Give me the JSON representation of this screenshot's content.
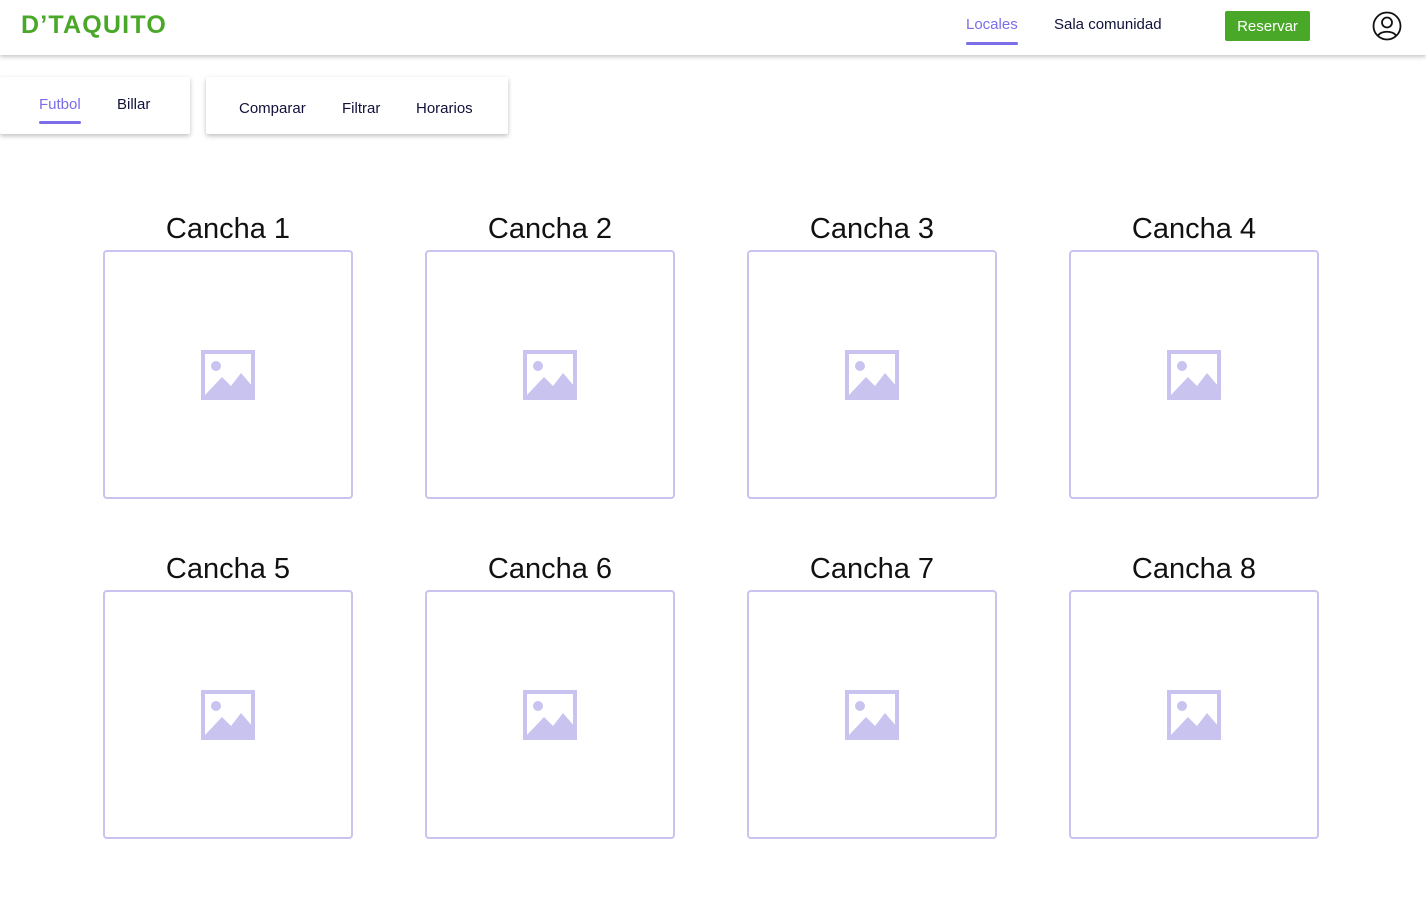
{
  "header": {
    "logo": "D’TAQUITO",
    "nav": [
      {
        "label": "Locales",
        "active": true
      },
      {
        "label": "Sala comunidad",
        "active": false
      }
    ],
    "reserve_label": "Reservar",
    "user_icon": "user-circle-icon"
  },
  "sport_tabs": [
    {
      "label": "Futbol",
      "active": true
    },
    {
      "label": "Billar",
      "active": false
    }
  ],
  "tools": [
    {
      "label": "Comparar"
    },
    {
      "label": "Filtrar"
    },
    {
      "label": "Horarios"
    }
  ],
  "courts": [
    {
      "title": "Cancha 1"
    },
    {
      "title": "Cancha 2"
    },
    {
      "title": "Cancha 3"
    },
    {
      "title": "Cancha 4"
    },
    {
      "title": "Cancha 5"
    },
    {
      "title": "Cancha 6"
    },
    {
      "title": "Cancha 7"
    },
    {
      "title": "Cancha 8"
    }
  ],
  "image_placeholder_icon": "image-placeholder-icon",
  "colors": {
    "brand_green": "#4aa829",
    "accent_purple": "#7b6ee8",
    "frame_lavender": "#c8c3ef",
    "text_dark": "#11113a"
  }
}
